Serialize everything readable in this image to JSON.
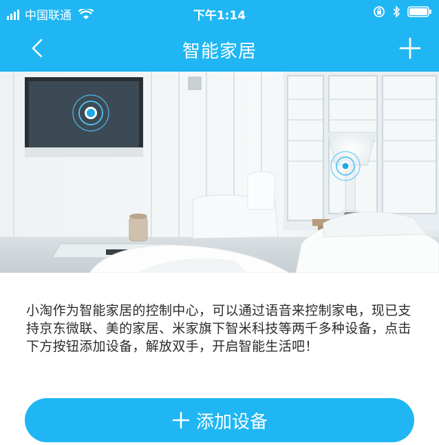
{
  "status_bar": {
    "carrier": "中国联通",
    "time": "下午1:14"
  },
  "nav": {
    "title": "智能家居",
    "back_icon": "chevron-left-icon",
    "add_icon": "plus-icon"
  },
  "description": "小淘作为智能家居的控制中心，可以通过语音来控制家电，现已支持京东微联、美的家居、米家旗下智米科技等两千多种设备，点击下方按钮添加设备，解放双手，开启智能生活吧！",
  "add_button": {
    "icon": "plus-icon",
    "label": "添加设备"
  },
  "colors": {
    "accent": "#1fb6f3",
    "text": "#2b2b2b",
    "background": "#ffffff"
  }
}
